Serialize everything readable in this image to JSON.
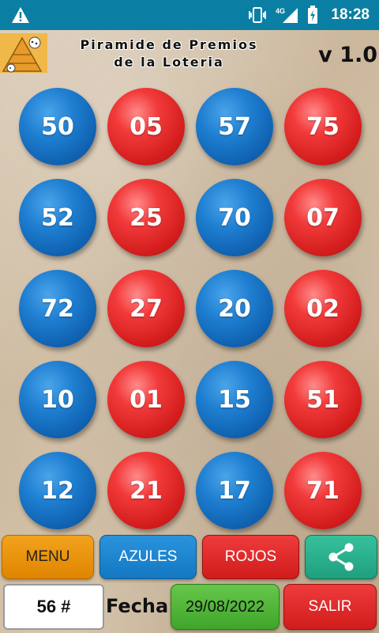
{
  "status_bar": {
    "time": "18:28",
    "network": "4G",
    "icons": [
      "warning-icon",
      "vibrate-icon",
      "signal-icon",
      "battery-icon"
    ]
  },
  "header": {
    "title_line1": "Piramide de Premios",
    "title_line2": "de la Loteria",
    "version": "v 1.0"
  },
  "balls": [
    {
      "number": "50",
      "color": "blue"
    },
    {
      "number": "05",
      "color": "red"
    },
    {
      "number": "57",
      "color": "blue"
    },
    {
      "number": "75",
      "color": "red"
    },
    {
      "number": "52",
      "color": "blue"
    },
    {
      "number": "25",
      "color": "red"
    },
    {
      "number": "70",
      "color": "blue"
    },
    {
      "number": "07",
      "color": "red"
    },
    {
      "number": "72",
      "color": "blue"
    },
    {
      "number": "27",
      "color": "red"
    },
    {
      "number": "20",
      "color": "blue"
    },
    {
      "number": "02",
      "color": "red"
    },
    {
      "number": "10",
      "color": "blue"
    },
    {
      "number": "01",
      "color": "red"
    },
    {
      "number": "15",
      "color": "blue"
    },
    {
      "number": "51",
      "color": "red"
    },
    {
      "number": "12",
      "color": "blue"
    },
    {
      "number": "21",
      "color": "red"
    },
    {
      "number": "17",
      "color": "blue"
    },
    {
      "number": "71",
      "color": "red"
    }
  ],
  "buttons": {
    "menu": "MENU",
    "azules": "AZULES",
    "rojos": "ROJOS",
    "share_icon": "share-icon"
  },
  "footer": {
    "count": "56 #",
    "fecha_label": "Fecha:",
    "date": "29/08/2022",
    "salir": "SALIR"
  },
  "colors": {
    "status_bar": "#0b7fa3",
    "blue_ball": "#1f7fd1",
    "red_ball": "#d31d1d",
    "menu": "#f2a21d",
    "share": "#1fa07e",
    "date": "#4fb533"
  }
}
